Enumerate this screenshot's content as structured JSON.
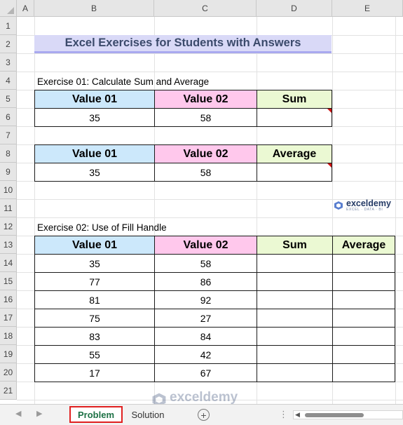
{
  "columns": [
    "A",
    "B",
    "C",
    "D",
    "E"
  ],
  "rows": [
    "1",
    "2",
    "3",
    "4",
    "5",
    "6",
    "7",
    "8",
    "9",
    "10",
    "11",
    "12",
    "13",
    "14",
    "15",
    "16",
    "17",
    "18",
    "19",
    "20",
    "21"
  ],
  "title": "Excel Exercises for Students with Answers",
  "exercise1": {
    "label": "Exercise 01: Calculate Sum and Average",
    "table1": {
      "headers": [
        "Value 01",
        "Value 02",
        "Sum"
      ],
      "row": [
        "35",
        "58",
        ""
      ]
    },
    "table2": {
      "headers": [
        "Value 01",
        "Value 02",
        "Average"
      ],
      "row": [
        "35",
        "58",
        ""
      ]
    }
  },
  "exercise2": {
    "label": "Exercise 02: Use of Fill Handle",
    "headers": [
      "Value 01",
      "Value 02",
      "Sum",
      "Average"
    ],
    "rows": [
      [
        "35",
        "58",
        "",
        ""
      ],
      [
        "77",
        "86",
        "",
        ""
      ],
      [
        "81",
        "92",
        "",
        ""
      ],
      [
        "75",
        "27",
        "",
        ""
      ],
      [
        "83",
        "84",
        "",
        ""
      ],
      [
        "55",
        "42",
        "",
        ""
      ],
      [
        "17",
        "67",
        "",
        ""
      ]
    ]
  },
  "brand": {
    "name": "exceldemy",
    "tagline": "EXCEL · DATA · BI"
  },
  "tabs": {
    "active": "Problem",
    "other": "Solution"
  },
  "colors": {
    "header_blue": "#cce8fb",
    "header_pink": "#ffc8ec",
    "header_green": "#ebf9d3",
    "title_bg": "#d9d9f7",
    "active_tab_border": "#e02020",
    "active_tab_text": "#1d7145",
    "comment_flag": "#d01010"
  },
  "icons": {
    "add_sheet": "plus-circle-icon",
    "nav_prev": "triangle-left-icon",
    "nav_next": "triangle-right-icon",
    "options": "vertical-dots-icon",
    "logo": "exceldemy-logo-icon"
  }
}
